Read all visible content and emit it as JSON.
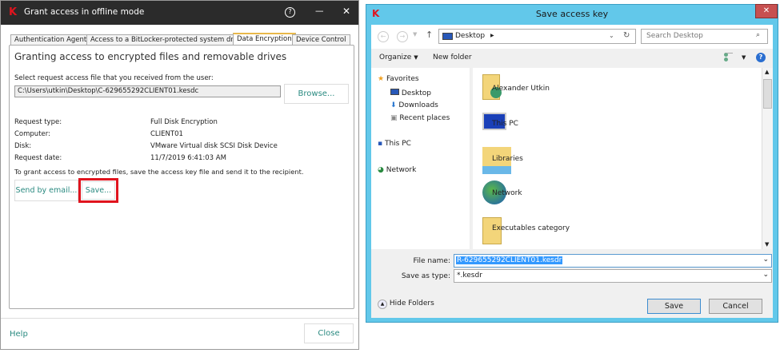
{
  "left_window": {
    "title": "Grant access in offline mode",
    "help_glyph": "?",
    "minimize_glyph": "—",
    "close_glyph": "✕",
    "tabs": [
      {
        "label": "Authentication Agent"
      },
      {
        "label": "Access to a BitLocker-protected system drive"
      },
      {
        "label": "Data Encryption",
        "active": true
      },
      {
        "label": "Device Control"
      }
    ],
    "heading": "Granting access to encrypted files and removable drives",
    "select_label": "Select request access file that you received from the user:",
    "file_path": "C:\\Users\\utkin\\Desktop\\C-629655292CLIENT01.kesdc",
    "browse_label": "Browse...",
    "details": [
      {
        "key": "Request type:",
        "value": "Full Disk Encryption"
      },
      {
        "key": "Computer:",
        "value": "CLIENT01"
      },
      {
        "key": "Disk:",
        "value": "VMware Virtual disk SCSI Disk Device"
      },
      {
        "key": "Request date:",
        "value": "11/7/2019 6:41:03 AM"
      }
    ],
    "instruction": "To grant access to encrypted files, save the access key file and send it to the recipient.",
    "send_email_label": "Send by email...",
    "save_label": "Save...",
    "help_link": "Help",
    "close_label": "Close",
    "highlight_color": "#e0141e",
    "accent_color": "#2a8a80"
  },
  "right_window": {
    "title": "Save access key",
    "close_glyph": "✕",
    "address": "Desktop",
    "search_placeholder": "Search Desktop",
    "organize_label": "Organize",
    "new_folder_label": "New folder",
    "nav": {
      "favorites": "Favorites",
      "favorites_items": [
        "Desktop",
        "Downloads",
        "Recent places"
      ],
      "this_pc": "This PC",
      "network": "Network"
    },
    "items": [
      "Alexander Utkin",
      "This PC",
      "Libraries",
      "Network",
      "Executables category"
    ],
    "file_name_label": "File name:",
    "file_name_value": "R-629655292CLIENT01.kesdr",
    "save_type_label": "Save as type:",
    "save_type_value": "*.kesdr",
    "hide_folders_label": "Hide Folders",
    "save_label": "Save",
    "cancel_label": "Cancel"
  }
}
